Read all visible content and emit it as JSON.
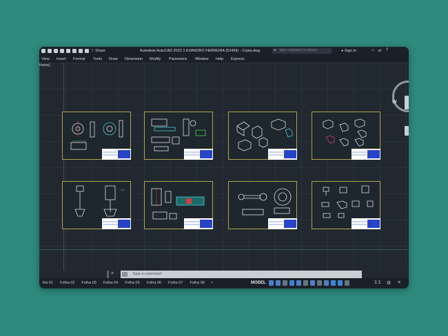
{
  "app": {
    "title": "Autodesk AutoCAD 2022   2.EVANDRO FERREIRA (52499) - Cópia.dwg",
    "share_label": "Share",
    "search_placeholder": "Type a keyword or phrase",
    "signin_label": "Sign In"
  },
  "menu": [
    "View",
    "Insert",
    "Format",
    "Tools",
    "Draw",
    "Dimension",
    "Modify",
    "Parametric",
    "Window",
    "Help",
    "Express"
  ],
  "viewport": {
    "label": "frame]",
    "viewcube_label": "W"
  },
  "command": {
    "placeholder": "Type a command"
  },
  "layout_tabs": [
    "lha 01",
    "Folha 02",
    "Folha 03",
    "Folha 04",
    "Folha 05",
    "Folha 06",
    "Folha 07",
    "Folha 08",
    "+"
  ],
  "status": {
    "model_label": "MODEL",
    "scale_label": "1:1"
  },
  "colors": {
    "background": "#2d8a7c",
    "sheet_border": "#b0a54a",
    "titleblock": "#2743c8"
  }
}
